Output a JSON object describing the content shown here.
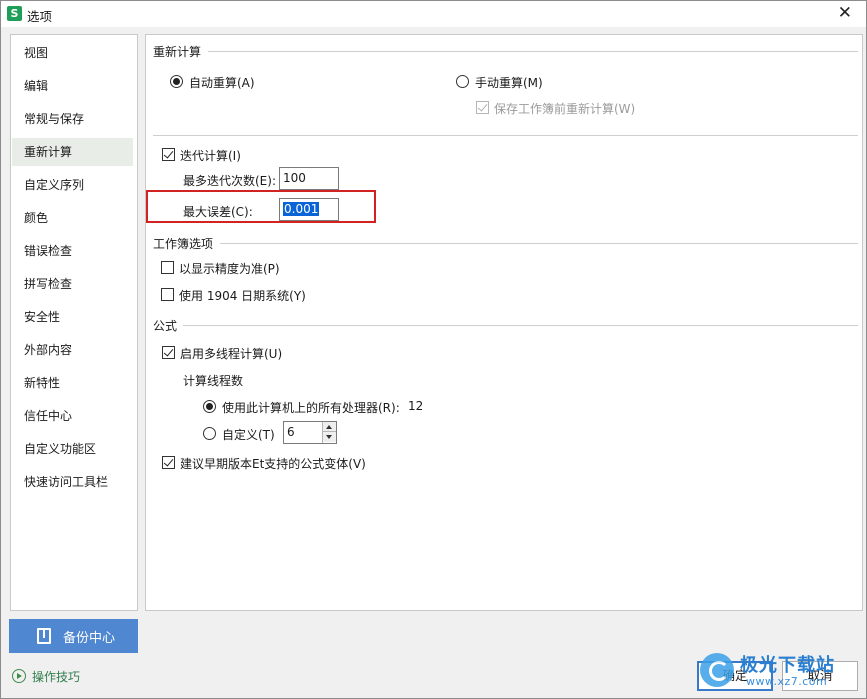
{
  "window": {
    "title": "选项",
    "app_icon_letter": "S",
    "close_glyph": "✕"
  },
  "sidebar": {
    "items": [
      {
        "label": "视图"
      },
      {
        "label": "编辑"
      },
      {
        "label": "常规与保存"
      },
      {
        "label": "重新计算",
        "active": true
      },
      {
        "label": "自定义序列"
      },
      {
        "label": "颜色"
      },
      {
        "label": "错误检查"
      },
      {
        "label": "拼写检查"
      },
      {
        "label": "安全性"
      },
      {
        "label": "外部内容"
      },
      {
        "label": "新特性"
      },
      {
        "label": "信任中心"
      },
      {
        "label": "自定义功能区"
      },
      {
        "label": "快速访问工具栏"
      }
    ]
  },
  "backup_button": {
    "label": "备份中心",
    "icon": "backup-icon"
  },
  "tips_link": {
    "label": "操作技巧",
    "icon": "play-circle-icon"
  },
  "recalc": {
    "section_title": "重新计算",
    "auto_label": "自动重算(A)",
    "auto_selected": true,
    "manual_label": "手动重算(M)",
    "manual_selected": false,
    "save_before_label": "保存工作簿前重新计算(W)",
    "save_before_checked": true,
    "save_before_enabled": false,
    "iterate_label": "迭代计算(I)",
    "iterate_checked": true,
    "max_iter_label": "最多迭代次数(E):",
    "max_iter_value": "100",
    "max_change_label": "最大误差(C):",
    "max_change_value": "0.001",
    "highlight_color": "#d32222"
  },
  "workbook": {
    "section_title": "工作簿选项",
    "precision_label": "以显示精度为准(P)",
    "precision_checked": false,
    "date1904_label": "使用 1904 日期系统(Y)",
    "date1904_checked": false
  },
  "formula": {
    "section_title": "公式",
    "multithread_label": "启用多线程计算(U)",
    "multithread_checked": true,
    "threads_title": "计算线程数",
    "use_all_label": "使用此计算机上的所有处理器(R):",
    "use_all_count": "12",
    "use_all_selected": true,
    "custom_label": "自定义(T)",
    "custom_selected": false,
    "custom_value": "6",
    "legacy_label": "建议早期版本Et支持的公式变体(V)",
    "legacy_checked": true
  },
  "footer": {
    "ok_label": "确定",
    "cancel_label": "取消",
    "accent_color": "#3a78c9"
  },
  "watermark": {
    "text": "极光下载站",
    "url": "www.xz7.com"
  }
}
